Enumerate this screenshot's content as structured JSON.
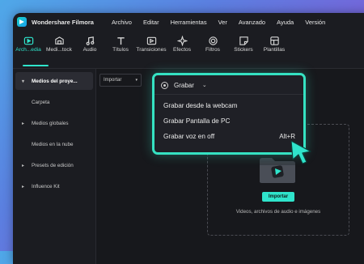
{
  "titlebar": {
    "app_name": "Wondershare Filmora",
    "menu": [
      "Archivo",
      "Editar",
      "Herramientas",
      "Ver",
      "Avanzado",
      "Ayuda",
      "Versión"
    ]
  },
  "toolbar": {
    "items": [
      {
        "label": "Arch...edia",
        "icon": "media-folder-icon",
        "active": true
      },
      {
        "label": "Medi...tock",
        "icon": "stock-media-icon"
      },
      {
        "label": "Audio",
        "icon": "music-note-icon"
      },
      {
        "label": "Títulos",
        "icon": "text-icon"
      },
      {
        "label": "Transiciones",
        "icon": "transition-icon"
      },
      {
        "label": "Efectos",
        "icon": "effects-sparkle-icon"
      },
      {
        "label": "Filtros",
        "icon": "filter-icon"
      },
      {
        "label": "Stickers",
        "icon": "sticker-icon"
      },
      {
        "label": "Plantillas",
        "icon": "template-icon"
      }
    ]
  },
  "sidebar": {
    "items": [
      {
        "label": "Medios del proye...",
        "expanded": true,
        "selected": true
      },
      {
        "label": "Carpeta",
        "child": true
      },
      {
        "label": "Medios globales"
      },
      {
        "label": "Medios en la nube",
        "child": true
      },
      {
        "label": "Presets de edición"
      },
      {
        "label": "Influence Kit"
      }
    ]
  },
  "content": {
    "import_dropdown": "Importar",
    "import_button": "Importar",
    "hint": "Videos, archivos de audio e imágenes"
  },
  "popup": {
    "header": "Grabar",
    "items": [
      {
        "label": "Grabar desde la webcam",
        "shortcut": ""
      },
      {
        "label": "Grabar Pantalla de PC",
        "shortcut": ""
      },
      {
        "label": "Grabar voz en off",
        "shortcut": "Alt+R"
      }
    ]
  },
  "colors": {
    "accent": "#2fe4cb",
    "highlight_border": "#35e2c2",
    "window_bg": "#1b1c21"
  }
}
